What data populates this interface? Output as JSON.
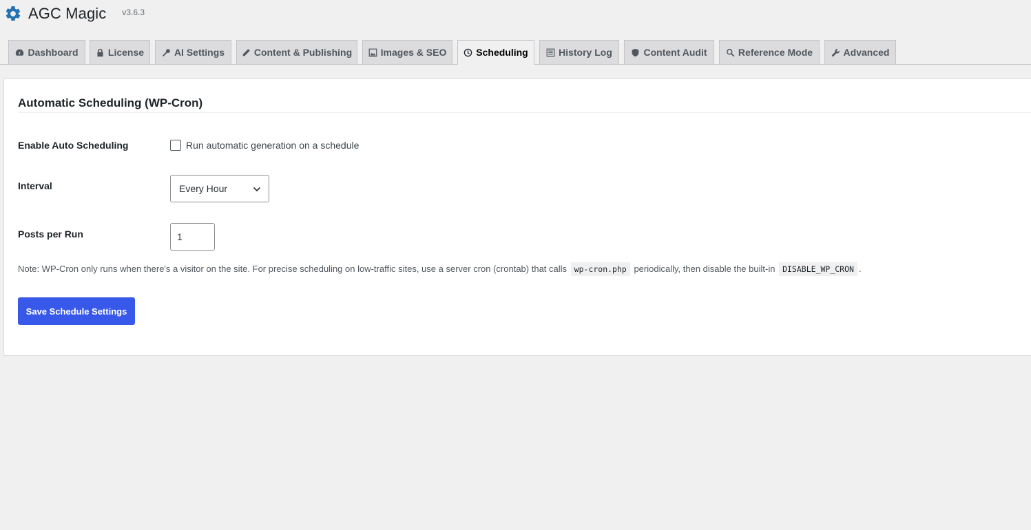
{
  "header": {
    "title": "AGC Magic",
    "version": "v3.6.3",
    "icon": "gear-icon",
    "icon_color": "#2271b1"
  },
  "tabs": [
    {
      "label": "Dashboard",
      "icon": "dashboard-icon",
      "active": false
    },
    {
      "label": "License",
      "icon": "lock-icon",
      "active": false
    },
    {
      "label": "AI Settings",
      "icon": "key-icon",
      "active": false
    },
    {
      "label": "Content & Publishing",
      "icon": "pencil-icon",
      "active": false
    },
    {
      "label": "Images & SEO",
      "icon": "image-icon",
      "active": false
    },
    {
      "label": "Scheduling",
      "icon": "clock-icon",
      "active": true
    },
    {
      "label": "History Log",
      "icon": "list-icon",
      "active": false
    },
    {
      "label": "Content Audit",
      "icon": "shield-icon",
      "active": false
    },
    {
      "label": "Reference Mode",
      "icon": "search-icon",
      "active": false
    },
    {
      "label": "Advanced",
      "icon": "wrench-icon",
      "active": false
    }
  ],
  "card": {
    "title": "Automatic Scheduling (WP-Cron)",
    "enable": {
      "label": "Enable Auto Scheduling",
      "checkbox_label": "Run automatic generation on a schedule",
      "checked": false
    },
    "interval": {
      "label": "Interval",
      "value": "Every Hour"
    },
    "posts_per_run": {
      "label": "Posts per Run",
      "value": "1"
    },
    "note": {
      "part1": "Note: WP-Cron only runs when there's a visitor on the site. For precise scheduling on low-traffic sites, use a server cron (crontab) that calls",
      "code1": "wp-cron.php",
      "part2": "periodically, then disable the built-in",
      "code2": "DISABLE_WP_CRON",
      "part3": "."
    },
    "save_label": "Save Schedule Settings"
  },
  "colors": {
    "primary_button": "#3858e9",
    "active_tab_bg": "#f0f0f1",
    "inactive_tab_bg": "#dcdcde"
  }
}
